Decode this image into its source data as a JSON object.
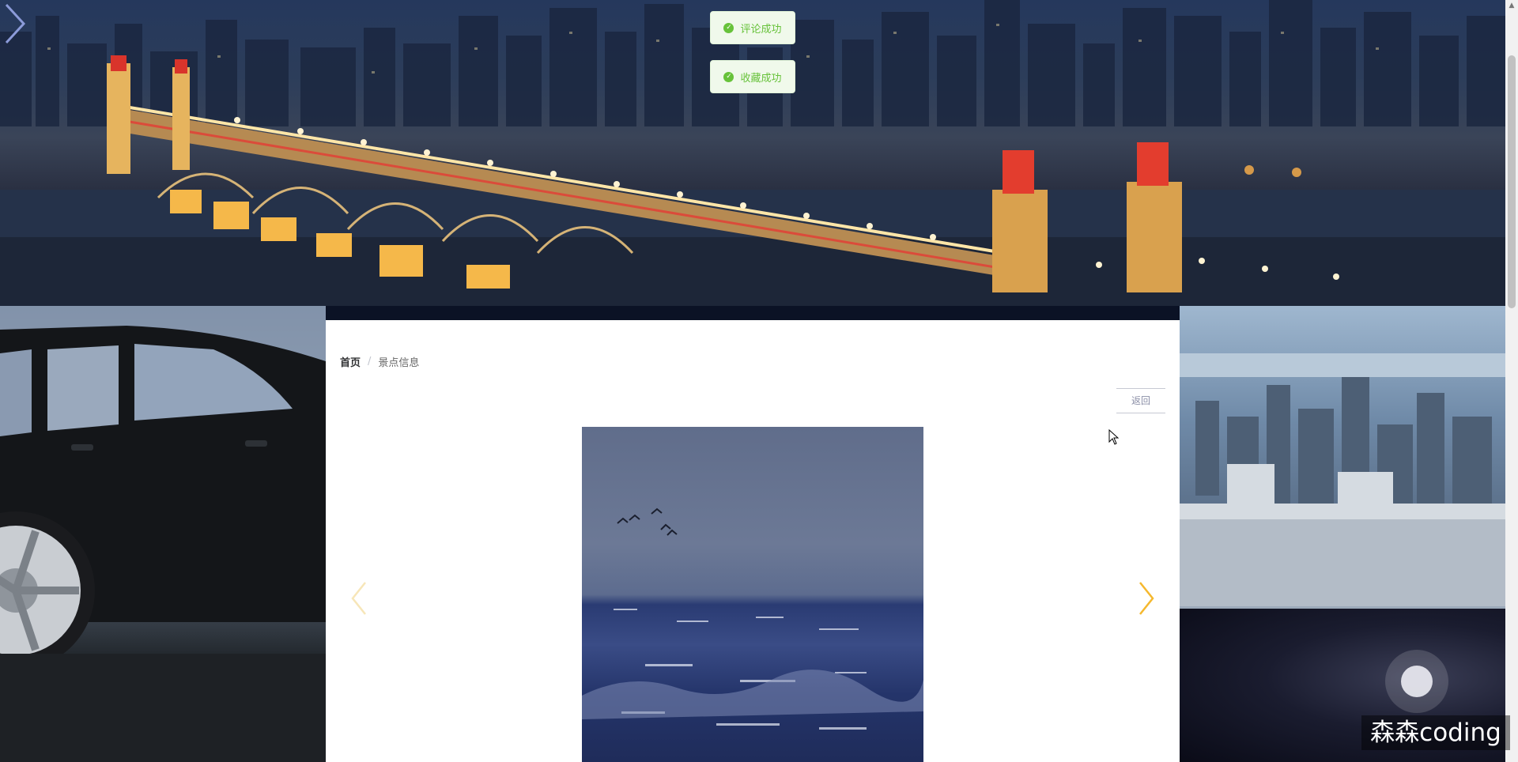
{
  "toasts": [
    {
      "text": "评论成功",
      "icon": "check-circle-icon"
    },
    {
      "text": "收藏成功",
      "icon": "check-circle-icon"
    }
  ],
  "breadcrumb": {
    "home": "首页",
    "separator": "/",
    "current": "景点信息"
  },
  "actions": {
    "back_label": "返回"
  },
  "carousel": {
    "prev_icon": "chevron-left-icon",
    "next_icon": "chevron-right-icon",
    "arrow_color": "#f5b82e"
  },
  "watermark": "森森coding",
  "colors": {
    "success": "#67c23a",
    "success_bg": "#f0f9eb",
    "panel_bg": "#ffffff"
  }
}
